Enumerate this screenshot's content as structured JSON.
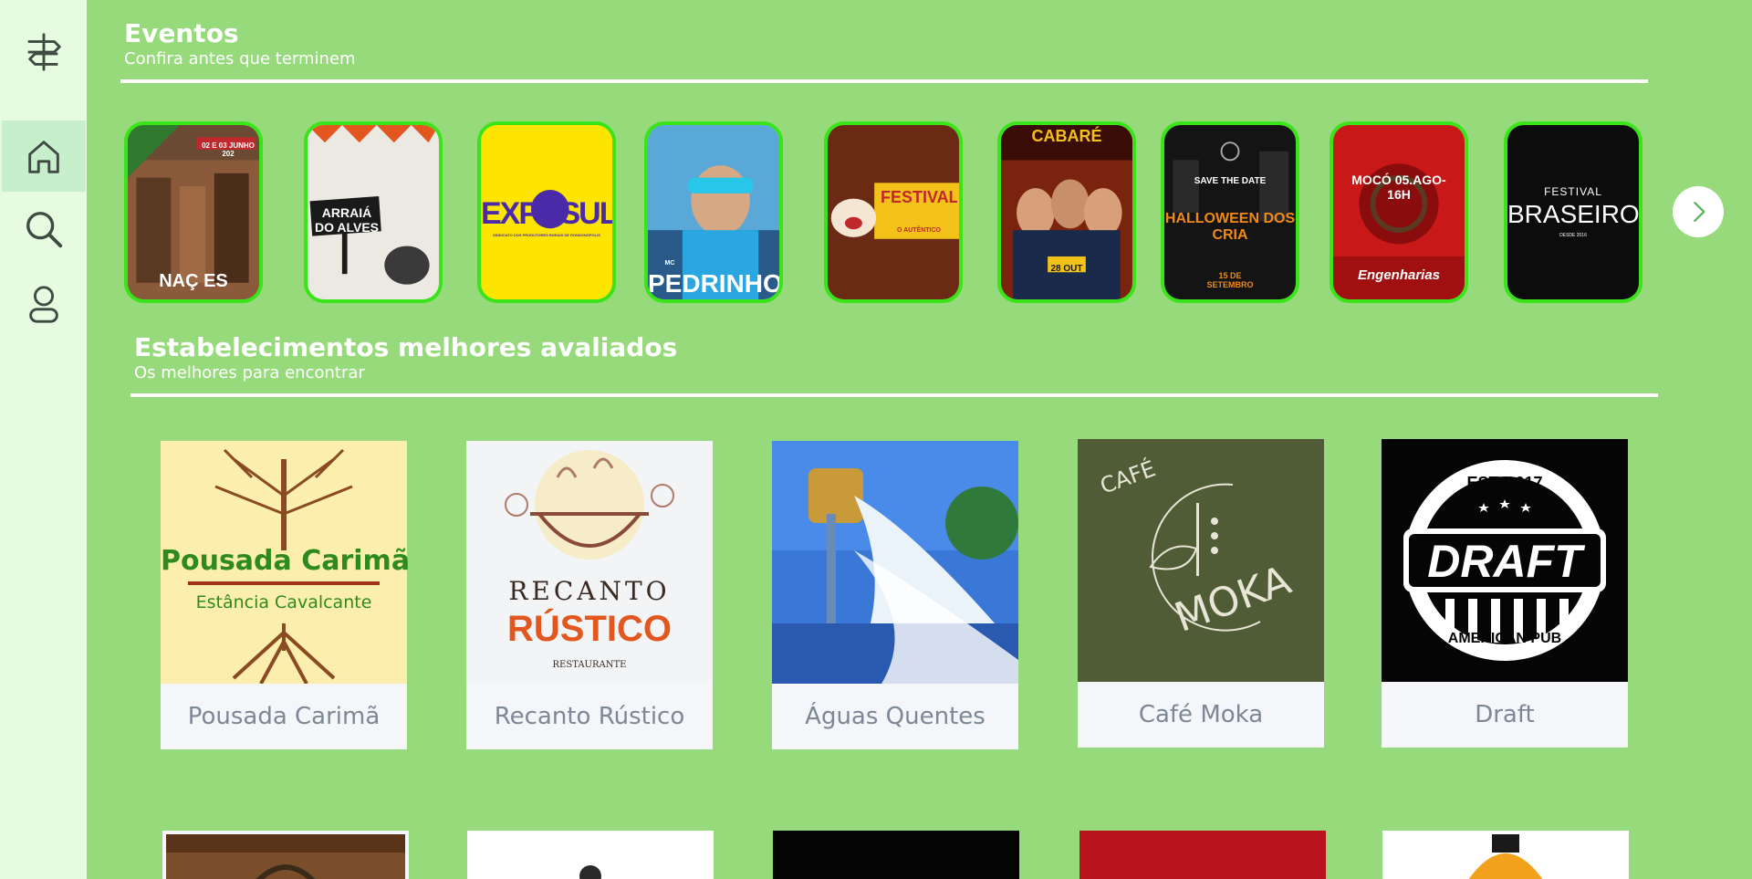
{
  "sidebar": {
    "items": [
      {
        "name": "logo",
        "icon": "signpost-icon"
      },
      {
        "name": "home",
        "icon": "home-icon",
        "active": true
      },
      {
        "name": "search",
        "icon": "search-icon"
      },
      {
        "name": "profile",
        "icon": "user-icon"
      }
    ]
  },
  "events_section": {
    "title": "Eventos",
    "subtitle": "Confira antes que terminem",
    "stories": [
      {
        "label": "NAÇ  ES",
        "date": "02 E 03 JUNHO 202"
      },
      {
        "label": "ARRAIÁ DO ALVES"
      },
      {
        "label": "EXPOSUL",
        "caption": "SINDICATO DOS PRODUTORES RURAIS DE RONDONÓPOLIS"
      },
      {
        "label": "PEDRINHO",
        "prefix": "MC"
      },
      {
        "label": "FESTIVAL DO TORRESMO",
        "caption": "O AUTÊNTICO"
      },
      {
        "label": "CABARÉ",
        "date": "28 OUT"
      },
      {
        "label": "HALLOWEEN DOS CRIA",
        "top": "SAVE THE DATE",
        "date": "15 DE SETEMBRO"
      },
      {
        "label": "MOCÓ 05.AGO-16H",
        "caption": "Engenharias"
      },
      {
        "label": "BRASEIRO",
        "top": "FESTIVAL",
        "caption": "DESDE 2016"
      }
    ],
    "next_icon": "chevron-right-icon"
  },
  "places_section": {
    "title": "Estabelecimentos melhores avaliados",
    "subtitle": "Os melhores para encontrar",
    "places": [
      {
        "name": "Pousada Carimã",
        "logo_title": "Pousada Carimã",
        "logo_sub": "Estância Cavalcante"
      },
      {
        "name": "Recanto Rústico",
        "logo_title": "RECANTO",
        "logo_title2": "RÚSTICO",
        "logo_sub": "RESTAURANTE"
      },
      {
        "name": "Águas Quentes"
      },
      {
        "name": "Café Moka",
        "logo_title": "CAFÉ",
        "logo_title2": "MOKA"
      },
      {
        "name": "Draft",
        "logo_title": "DRAFT",
        "logo_top": "EST. 2017",
        "logo_sub": "AMERICAN PUB"
      }
    ]
  },
  "colors": {
    "background": "#97da7c",
    "sidebar": "#e6fbe0",
    "story_border": "#39e419",
    "card_label": "#7d8796"
  }
}
